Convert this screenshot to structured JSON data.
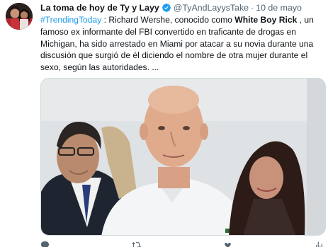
{
  "tweet": {
    "display_name": "La toma de hoy de Ty y Layy",
    "handle": "@TyAndLayysTake",
    "separator": "·",
    "date": "10 de mayo",
    "text": {
      "hashtag": "#TrendingToday",
      "part1": " : Richard Wershe, conocido como ",
      "bold": "White Boy Rick",
      "part2": " , un famoso ex informante del FBI convertido en traficante de drogas en Michigan, ha sido arrestado en Miami por atacar a su novia durante una discusión que surgió de él diciendo el nombre de otra mujer durante el sexo, según las autoridades. ..."
    },
    "icons": {
      "verified": "verified-badge-icon",
      "reply": "reply-icon",
      "retweet": "retweet-icon",
      "like": "like-icon",
      "views": "views-icon"
    },
    "colors": {
      "accent": "#1d9bf0",
      "text": "#0f1419",
      "secondary": "#536471"
    }
  }
}
